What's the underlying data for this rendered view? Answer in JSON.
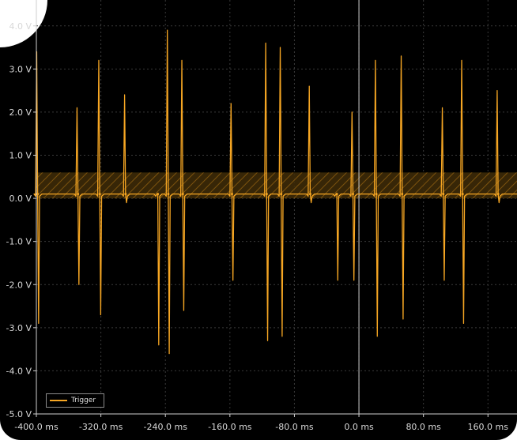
{
  "chart_data": {
    "type": "line",
    "title": "",
    "xlabel": "",
    "ylabel": "",
    "xlim": [
      -400,
      196
    ],
    "ylim": [
      -5,
      4.6
    ],
    "x_ticks": [
      "-400.0 ms",
      "-320.0 ms",
      "-240.0 ms",
      "-160.0 ms",
      "-80.0 ms",
      "0.0 ms",
      "80.0 ms",
      "160.0 ms"
    ],
    "x_tick_values": [
      -400,
      -320,
      -240,
      -160,
      -80,
      0,
      80,
      160
    ],
    "y_ticks": [
      "4.0 V",
      "3.0 V",
      "2.0 V",
      "1.0 V",
      "0.0 V",
      "-1.0 V",
      "-2.0 V",
      "-3.0 V",
      "-4.0 V",
      "-5.0 V"
    ],
    "y_tick_values": [
      4,
      3,
      2,
      1,
      0,
      -1,
      -2,
      -3,
      -4,
      -5
    ],
    "grid": true,
    "legend": "bottom-left",
    "trigger_line_x": 0,
    "trigger_band": [
      0,
      0.6
    ],
    "baseline": 0.1,
    "series": [
      {
        "name": "Trigger",
        "color": "#f6a623",
        "spikes": [
          {
            "x": -399,
            "peak": 3.4,
            "trough": -2.9
          },
          {
            "x": -349,
            "peak": 2.1,
            "trough": -2.0
          },
          {
            "x": -322,
            "peak": 3.2,
            "trough": -2.7
          },
          {
            "x": -290,
            "peak": 2.4,
            "trough": -0.1
          },
          {
            "x": -250,
            "peak": -0.1,
            "trough": -3.4
          },
          {
            "x": -237,
            "peak": 3.9,
            "trough": -3.6
          },
          {
            "x": -219,
            "peak": 3.2,
            "trough": -2.6
          },
          {
            "x": -158,
            "peak": 2.2,
            "trough": -1.9
          },
          {
            "x": -115,
            "peak": 3.6,
            "trough": -3.3
          },
          {
            "x": -97,
            "peak": 3.5,
            "trough": -3.2
          },
          {
            "x": -61,
            "peak": 2.6,
            "trough": -0.1
          },
          {
            "x": -28,
            "peak": -0.1,
            "trough": -1.9
          },
          {
            "x": -8,
            "peak": 2.0,
            "trough": -1.9
          },
          {
            "x": 21,
            "peak": 3.2,
            "trough": -3.2
          },
          {
            "x": 53,
            "peak": 3.3,
            "trough": -2.8
          },
          {
            "x": 104,
            "peak": 2.1,
            "trough": -1.9
          },
          {
            "x": 128,
            "peak": 3.2,
            "trough": -2.9
          },
          {
            "x": 172,
            "peak": 2.5,
            "trough": -0.1
          }
        ]
      }
    ]
  }
}
